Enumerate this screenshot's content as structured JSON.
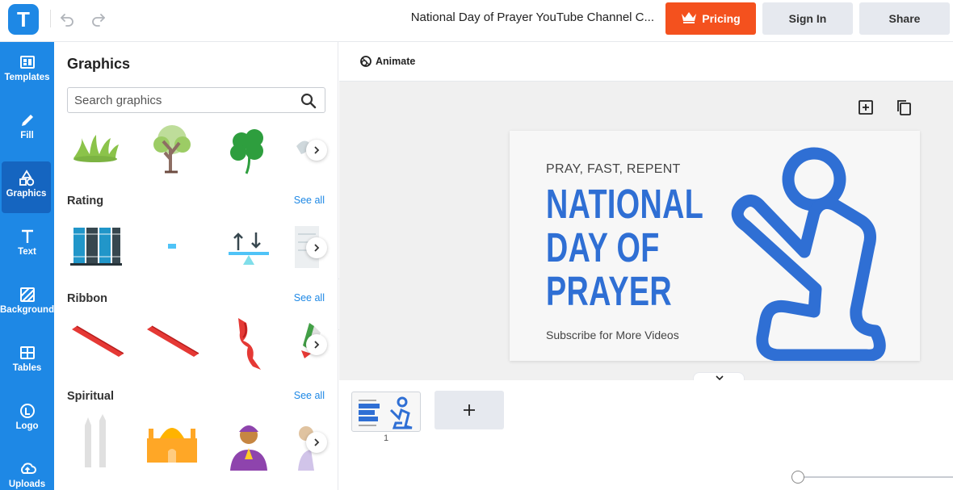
{
  "app": {
    "logo_letter": "T",
    "doc_title": "National Day of Prayer YouTube Channel C...",
    "accent": "#1e88e5",
    "pricing_color": "#f4511e"
  },
  "toolbar": {
    "pricing_label": "Pricing",
    "signin_label": "Sign In",
    "share_label": "Share",
    "animate_label": "Animate"
  },
  "rail": {
    "items": [
      {
        "label": "Templates",
        "icon": "templates-icon"
      },
      {
        "label": "Fill",
        "icon": "pencil-icon"
      },
      {
        "label": "Graphics",
        "icon": "shapes-icon"
      },
      {
        "label": "Text",
        "icon": "text-icon"
      },
      {
        "label": "Background",
        "icon": "background-icon"
      },
      {
        "label": "Tables",
        "icon": "table-icon"
      },
      {
        "label": "Logo",
        "icon": "logo-icon"
      },
      {
        "label": "Uploads",
        "icon": "upload-icon"
      }
    ],
    "active": "Graphics"
  },
  "panel": {
    "title": "Graphics",
    "search_placeholder": "Search graphics",
    "sections": [
      {
        "title": "Rating",
        "see_all": "See all"
      },
      {
        "title": "Ribbon",
        "see_all": "See all"
      },
      {
        "title": "Spiritual",
        "see_all": "See all"
      }
    ]
  },
  "slide": {
    "tagline": "PRAY, FAST, REPENT",
    "headline_lines": [
      "NATIONAL",
      "DAY OF",
      "PRAYER"
    ],
    "subtitle": "Subscribe for More Videos",
    "headline_color": "#2f6fd4"
  },
  "pages": {
    "current_page": "1"
  }
}
